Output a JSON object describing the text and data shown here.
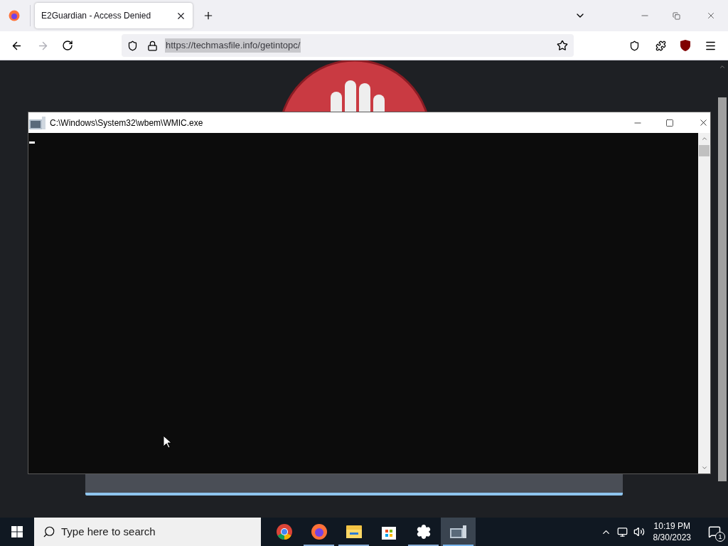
{
  "browser": {
    "tabs": [
      {
        "title": "E2Guardian - Access Denied",
        "selected": true
      }
    ],
    "url": "https://techmasfile.info/getintopc/"
  },
  "console": {
    "title": "C:\\Windows\\System32\\wbem\\WMIC.exe"
  },
  "taskbar": {
    "search": {
      "placeholder": "Type here to search"
    },
    "apps": [
      {
        "kind": "chrome",
        "running": false,
        "selected": false
      },
      {
        "kind": "firefox",
        "running": true,
        "selected": false
      },
      {
        "kind": "explorer",
        "running": true,
        "selected": false
      },
      {
        "kind": "store",
        "running": false,
        "selected": false
      },
      {
        "kind": "settings",
        "running": true,
        "selected": false
      },
      {
        "kind": "console",
        "running": true,
        "selected": true
      }
    ],
    "time": "10:19 PM",
    "date": "8/30/2023",
    "notifications": "1"
  }
}
